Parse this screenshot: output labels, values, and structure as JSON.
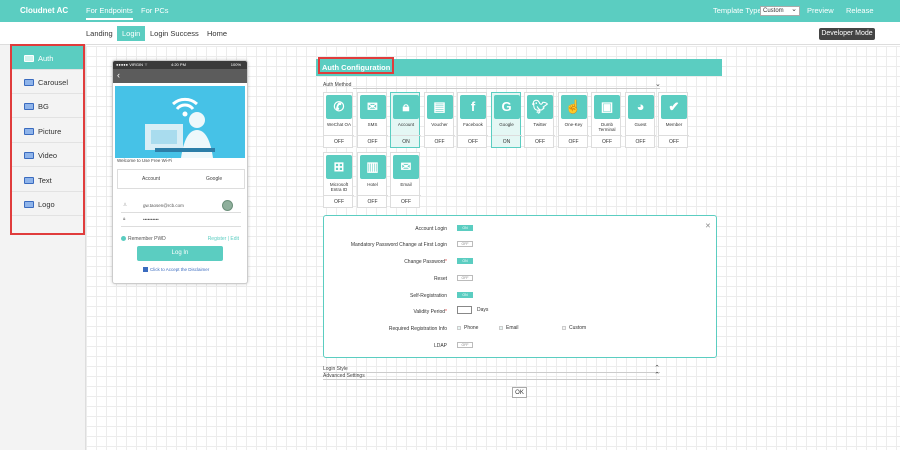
{
  "app": {
    "title": "Cloudnet AC",
    "tabs": [
      {
        "label": "For Endpoints"
      },
      {
        "label": "For PCs"
      }
    ],
    "template_type_label": "Template Type",
    "template_type_value": "Custom",
    "preview_label": "Preview",
    "release_label": "Release"
  },
  "subnav": {
    "items": [
      {
        "label": "Landing"
      },
      {
        "label": "Login"
      },
      {
        "label": "Login Success"
      },
      {
        "label": "Home"
      }
    ],
    "developer_mode_label": "Developer Mode"
  },
  "sidebar": {
    "items": [
      {
        "label": "Auth"
      },
      {
        "label": "Carousel"
      },
      {
        "label": "BG"
      },
      {
        "label": "Picture"
      },
      {
        "label": "Video"
      },
      {
        "label": "Text"
      },
      {
        "label": "Logo"
      }
    ]
  },
  "phone": {
    "status_left": "●●●●● VIRGIN ⌔",
    "status_time": "4:20 PM",
    "status_right": "100%",
    "welcome": "Welcome to Use Free Wi-Fi",
    "tab_account": "Account",
    "tab_google": "Google",
    "username": "gw.taosen@rcb.com",
    "password": "••••••••••",
    "remember": "Remember PWD",
    "register": "Register | Edit",
    "login_button": "Log In",
    "disclaimer": "Click to Accept the Disclaimer"
  },
  "auth": {
    "header": "Auth Configuration",
    "method_label": "Auth Method",
    "tiles": [
      {
        "label": "WeChat OA",
        "state": "OFF"
      },
      {
        "label": "SMS",
        "state": "OFF"
      },
      {
        "label": "Account",
        "state": "ON"
      },
      {
        "label": "Voucher",
        "state": "OFF"
      },
      {
        "label": "Facebook",
        "state": "OFF"
      },
      {
        "label": "Google",
        "state": "ON"
      },
      {
        "label": "Twitter",
        "state": "OFF"
      },
      {
        "label": "One-Key",
        "state": "OFF"
      },
      {
        "label": "Dumb Terminal",
        "state": "OFF"
      },
      {
        "label": "Guest",
        "state": "OFF"
      },
      {
        "label": "Member",
        "state": "OFF"
      },
      {
        "label": "Microsoft Entra ID",
        "state": "OFF"
      },
      {
        "label": "Hotel",
        "state": "OFF"
      },
      {
        "label": "Email",
        "state": "OFF"
      }
    ],
    "config": {
      "account_login": "Account Login",
      "mandatory_pwd": "Mandatory Password Change at First Login",
      "change_password": "Change Password",
      "reset": "Reset",
      "self_registration": "Self-Registration",
      "validity_period": "Validity Period",
      "days": "Days",
      "required_info": "Required Registration Info",
      "info_phone": "Phone",
      "info_email": "Email",
      "info_custom": "Custom",
      "ldap": "LDAP",
      "toggle_on": "ON",
      "toggle_off": "OFF"
    },
    "login_style": "Login Style",
    "advanced_settings": "Advanced Settings",
    "ok_label": "OK"
  },
  "colors": {
    "accent": "#5bcdc1",
    "highlight_frame": "#e03c3c",
    "banner": "#46c2e7"
  }
}
